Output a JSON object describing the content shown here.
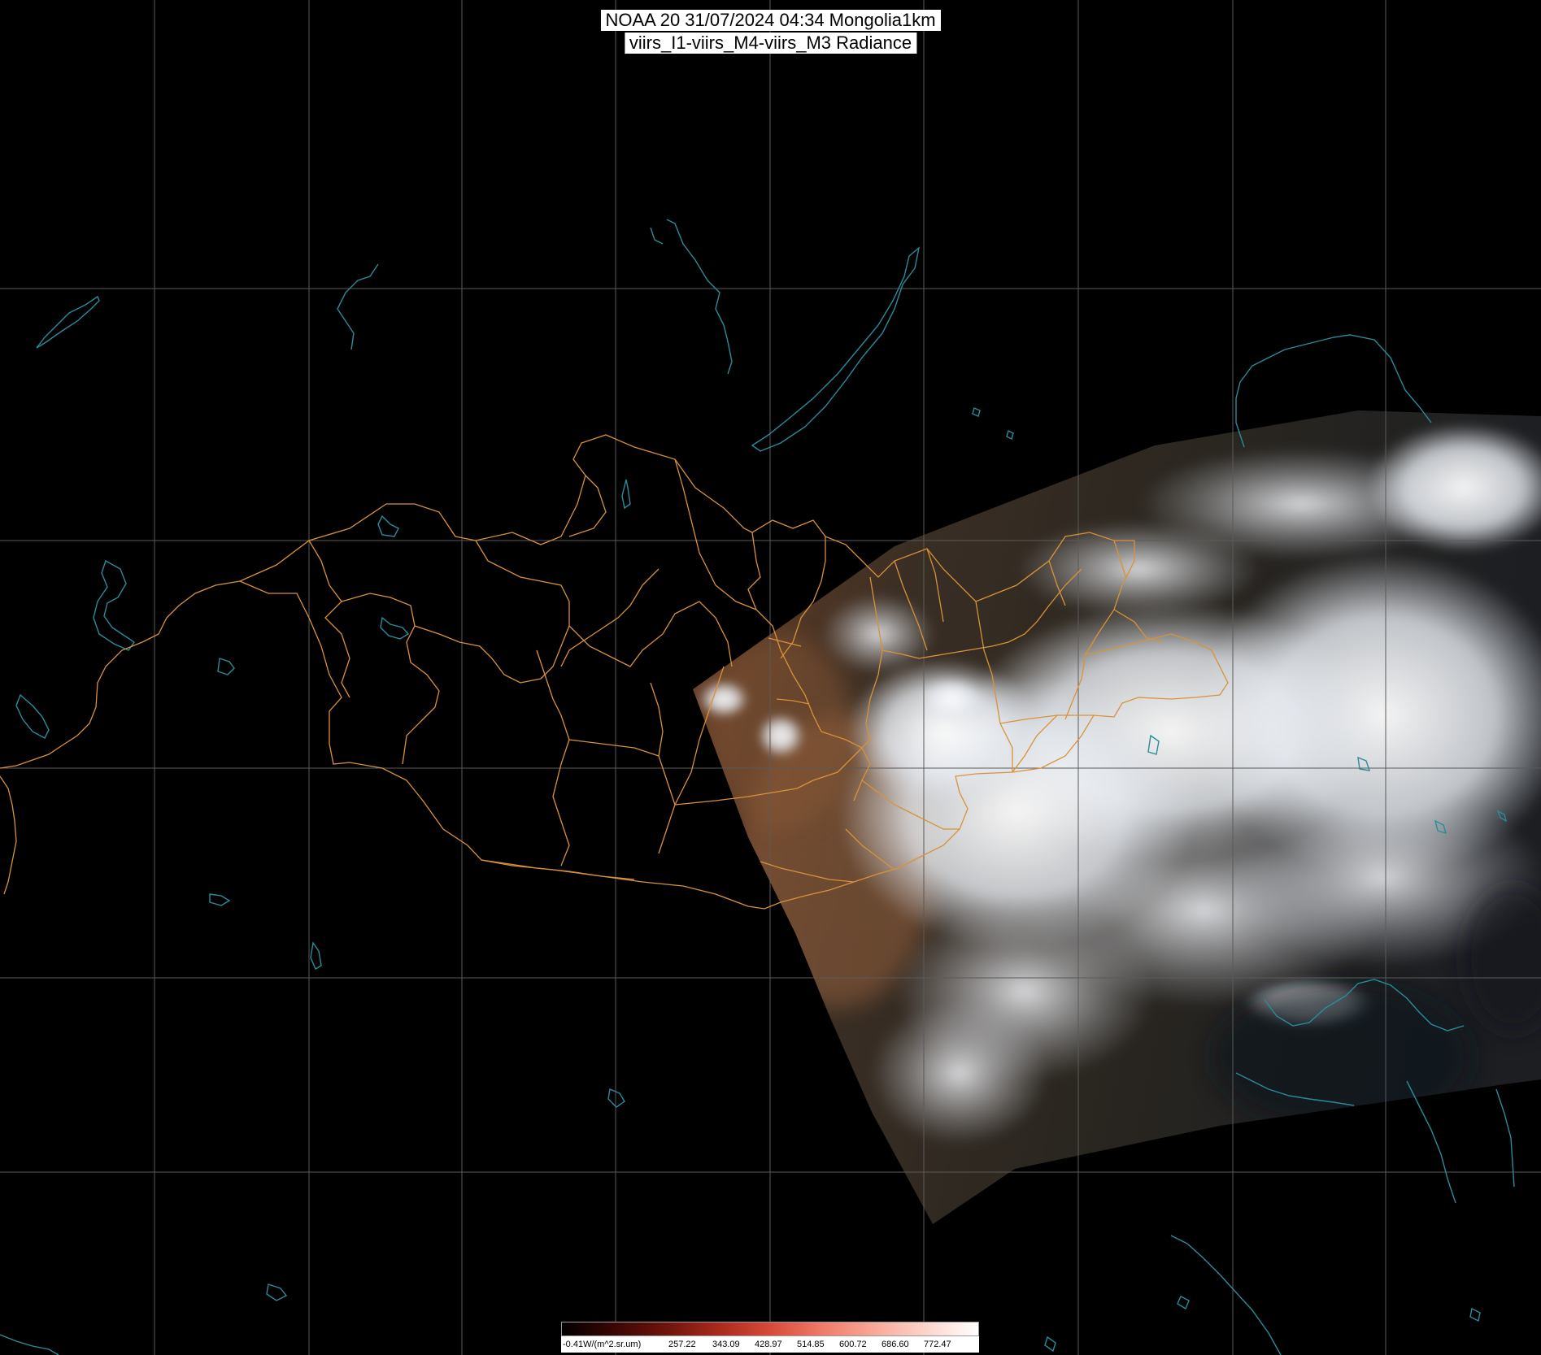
{
  "title": {
    "line1": "NOAA 20 31/07/2024 04:34 Mongolia1km",
    "line2": "viirs_I1-viirs_M4-viirs_M3 Radiance"
  },
  "colorbar": {
    "labels": [
      "-0.41W/(m^2.sr.um)",
      "257.22",
      "343.09",
      "428.97",
      "514.85",
      "600.72",
      "686.60",
      "772.47"
    ],
    "colors": [
      "#000000",
      "#3a0604",
      "#6e140c",
      "#a82a1c",
      "#d84a38",
      "#f07a68",
      "#f8a898",
      "#fcd4cc",
      "#ffffff"
    ]
  },
  "colors": {
    "background": "#000000",
    "graticule": "#5a5a5a",
    "coastline": "#2a8c9a",
    "admin_boundary": "#d8923a",
    "cloud": "#f2f4f8",
    "land_dark": "#2a241c",
    "land_desert": "#8a5636"
  },
  "layers": [
    "satellite-swath",
    "coastlines",
    "admin-boundaries",
    "graticule"
  ]
}
